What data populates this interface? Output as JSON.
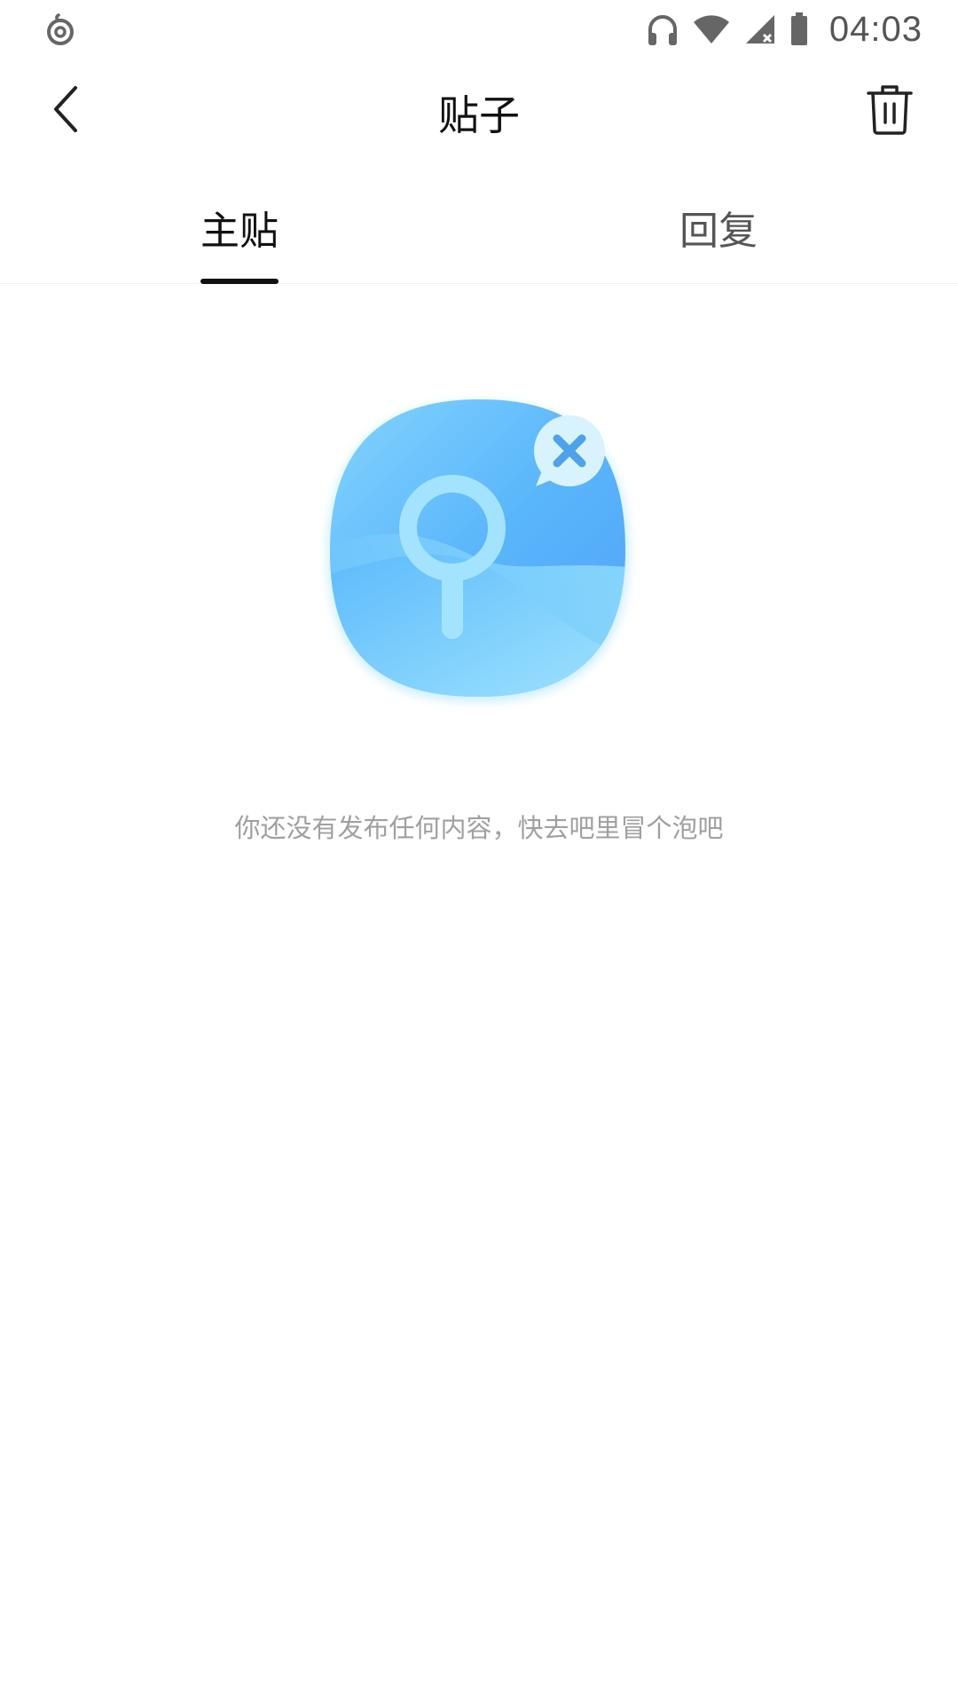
{
  "status_bar": {
    "time": "04:03",
    "icons": [
      "app-notification-icon",
      "headphones-icon",
      "wifi-icon",
      "cellular-no-signal-icon",
      "battery-icon"
    ]
  },
  "header": {
    "title": "贴子",
    "back_icon": "chevron-left-icon",
    "action_icon": "trash-icon"
  },
  "tabs": [
    {
      "label": "主贴",
      "active": true
    },
    {
      "label": "回复",
      "active": false
    }
  ],
  "empty_state": {
    "illustration": "search-no-result-icon",
    "message": "你还没有发布任何内容，快去吧里冒个泡吧"
  },
  "colors": {
    "title_text": "#111111",
    "inactive_tab": "#555555",
    "hint_text": "#a0a0a0",
    "illustration_blue": "#5ab6fb"
  }
}
